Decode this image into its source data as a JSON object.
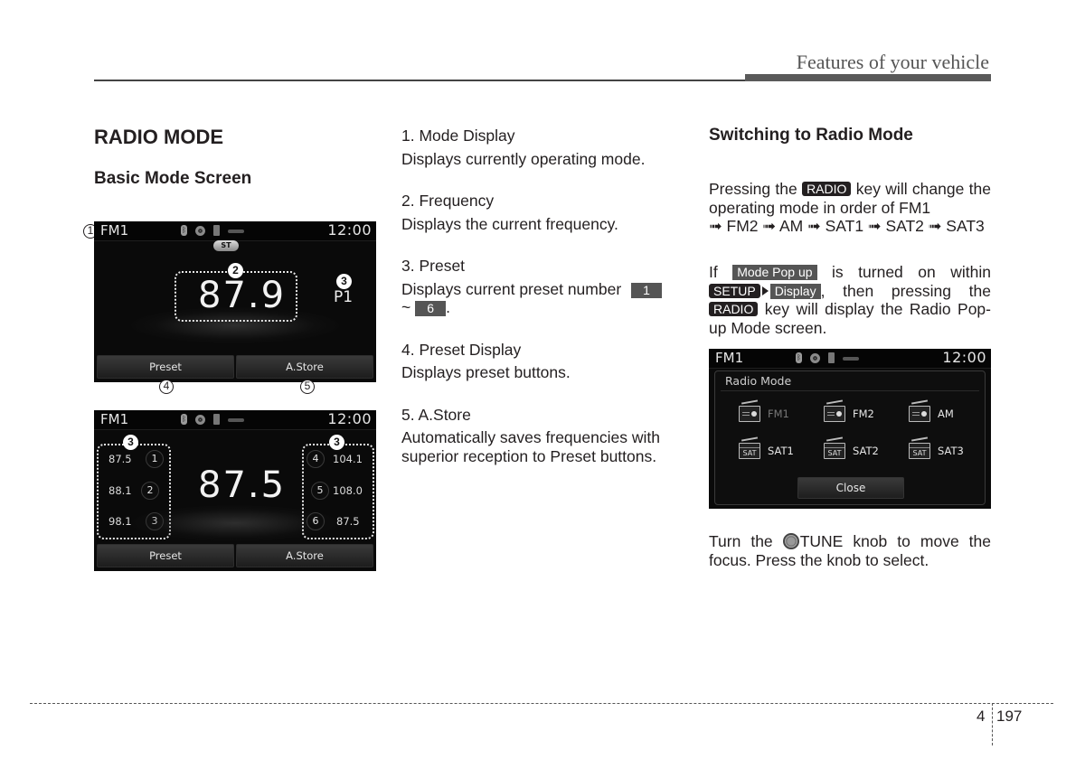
{
  "header": {
    "section_title": "Features of your vehicle"
  },
  "left": {
    "title": "RADIO MODE",
    "subtitle": "Basic Mode Screen",
    "screen1": {
      "mode": "FM1",
      "clock": "12:00",
      "stereo_badge": "ST",
      "frequency": "87.9",
      "preset": "P1",
      "buttons": [
        "Preset",
        "A.Store"
      ],
      "callouts": [
        "1",
        "2",
        "3",
        "4",
        "5"
      ]
    },
    "screen2": {
      "mode": "FM1",
      "clock": "12:00",
      "frequency": "87.5",
      "callout": "3",
      "presets_left": [
        {
          "freq": "87.5",
          "num": "1"
        },
        {
          "freq": "88.1",
          "num": "2"
        },
        {
          "freq": "98.1",
          "num": "3"
        }
      ],
      "presets_right": [
        {
          "freq": "104.1",
          "num": "4"
        },
        {
          "freq": "108.0",
          "num": "5"
        },
        {
          "freq": "87.5",
          "num": "6"
        }
      ],
      "buttons": [
        "Preset",
        "A.Store"
      ]
    }
  },
  "middle": {
    "items": [
      {
        "title": "1. Mode Display",
        "desc": "Displays currently operating mode."
      },
      {
        "title": "2. Frequency",
        "desc": "Displays the current frequency."
      },
      {
        "title": "3. Preset",
        "desc_pre": "Displays current preset number",
        "box1": "1",
        "tilde": "~",
        "box2": "6",
        "desc_post": "."
      },
      {
        "title": "4. Preset Display",
        "desc": "Displays preset buttons."
      },
      {
        "title": "5. A.Store",
        "desc": "Automatically saves frequencies with superior reception to Preset buttons."
      }
    ]
  },
  "right": {
    "title": "Switching to Radio Mode",
    "p1": {
      "pre": "Pressing the",
      "key": "RADIO",
      "post": "key will change the operating mode in order of FM1",
      "order": "➟ FM2 ➟ AM ➟ SAT1 ➟ SAT2 ➟ SAT3"
    },
    "p2": {
      "if": "If",
      "setting": "Mode Pop up",
      "mid": "is turned on within",
      "setup_key": "SETUP",
      "display_key": "Display",
      "mid2": ", then pressing the",
      "radio_key": "RADIO",
      "post": "key will display the Radio Pop-up Mode screen."
    },
    "screen3": {
      "mode": "FM1",
      "clock": "12:00",
      "popup_title": "Radio Mode",
      "items": [
        {
          "label": "FM1",
          "icon": "radio-icon",
          "dim": true
        },
        {
          "label": "FM2",
          "icon": "radio-icon",
          "dim": false
        },
        {
          "label": "AM",
          "icon": "radio-icon",
          "dim": false
        },
        {
          "label": "SAT1",
          "icon": "sat-radio-icon",
          "dim": false
        },
        {
          "label": "SAT2",
          "icon": "sat-radio-icon",
          "dim": false
        },
        {
          "label": "SAT3",
          "icon": "sat-radio-icon",
          "dim": false
        }
      ],
      "close_label": "Close"
    },
    "p3": {
      "pre": "Turn the",
      "knob": "TUNE",
      "post": "knob to move the focus. Press the knob to select."
    }
  },
  "footer": {
    "chapter": "4",
    "page": "197"
  }
}
